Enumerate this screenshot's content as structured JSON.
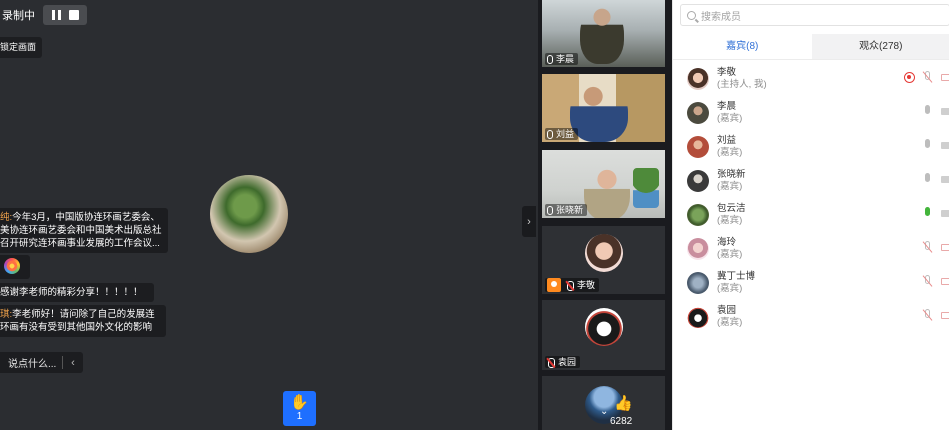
{
  "recording": {
    "label": "录制中"
  },
  "stage": {
    "lock_view_label": "锁定画面",
    "say_placeholder": "说点什么..."
  },
  "chat": [
    {
      "who": "纯:",
      "text": "今年3月，中国版协连环画艺委会、美协连环画艺委会和中国美术出版总社召开研究连环画事业发展的工作会议..."
    },
    {
      "who": "",
      "text": ""
    },
    {
      "who": "",
      "text": "感谢李老师的精彩分享！！！！！"
    },
    {
      "who": "琪:",
      "text": "李老师好！请问除了自己的发展连环画有没有受到其他国外文化的影响"
    }
  ],
  "hand_raise": {
    "count": "1"
  },
  "videos": [
    {
      "name": "李晨"
    },
    {
      "name": "刘益"
    },
    {
      "name": "张晓新"
    },
    {
      "name": "李敬"
    },
    {
      "name": "袁园"
    },
    {
      "likes": "6282"
    }
  ],
  "panel": {
    "search_placeholder": "搜索成员",
    "tabs": [
      {
        "label": "嘉宾(8)",
        "active": true
      },
      {
        "label": "观众(278)",
        "active": false
      }
    ],
    "members": [
      {
        "name": "李敬",
        "role": "(主持人, 我)",
        "mic": "off",
        "recording": true
      },
      {
        "name": "李晨",
        "role": "(嘉宾)",
        "mic": "idle"
      },
      {
        "name": "刘益",
        "role": "(嘉宾)",
        "mic": "idle"
      },
      {
        "name": "张晓新",
        "role": "(嘉宾)",
        "mic": "idle"
      },
      {
        "name": "包云洁",
        "role": "(嘉宾)",
        "mic": "on"
      },
      {
        "name": "海玲",
        "role": "(嘉宾)",
        "mic": "off"
      },
      {
        "name": "冀丁士博",
        "role": "(嘉宾)",
        "mic": "off"
      },
      {
        "name": "袁园",
        "role": "(嘉宾)",
        "mic": "off"
      }
    ]
  },
  "colors": {
    "accent": "#2f6fd6",
    "hand_button": "#1e6fff",
    "stage_bg": "#2b2d31",
    "chat_name": "#f3a44b"
  }
}
